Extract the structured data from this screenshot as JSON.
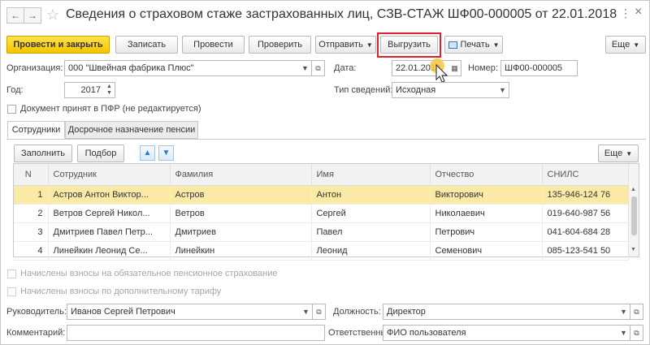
{
  "window": {
    "title": "Сведения о страховом стаже застрахованных лиц, СЗВ-СТАЖ ШФ00-000005 от 22.01.2018",
    "close_glyph": "×",
    "menu_glyph": "⋮"
  },
  "toolbar": {
    "post_close": "Провести и закрыть",
    "save": "Записать",
    "post": "Провести",
    "check": "Проверить",
    "send": "Отправить",
    "upload": "Выгрузить",
    "print": "Печать",
    "more": "Еще"
  },
  "form": {
    "org_label": "Организация:",
    "org_value": "000 \"Швейная фабрика Плюс\"",
    "date_label": "Дата:",
    "date_value": "22.01.2018",
    "number_label": "Номер:",
    "number_value": "ШФ00-000005",
    "year_label": "Год:",
    "year_value": "2017",
    "info_type_label": "Тип сведений:",
    "info_type_value": "Исходная",
    "accepted_label": "Документ принят в ПФР (не редактируется)"
  },
  "tabs": [
    {
      "label": "Сотрудники",
      "active": true
    },
    {
      "label": "Досрочное назначение пенсии",
      "active": false
    }
  ],
  "table_toolbar": {
    "fill": "Заполнить",
    "select": "Подбор",
    "more": "Еще"
  },
  "table": {
    "columns": [
      "N",
      "Сотрудник",
      "Фамилия",
      "Имя",
      "Отчество",
      "СНИЛС"
    ],
    "rows": [
      [
        "1",
        "Астров Антон Виктор...",
        "Астров",
        "Антон",
        "Викторович",
        "135-946-124 76"
      ],
      [
        "2",
        "Ветров Сергей Никол...",
        "Ветров",
        "Сергей",
        "Николаевич",
        "019-640-987 56"
      ],
      [
        "3",
        "Дмитриев Павел Петр...",
        "Дмитриев",
        "Павел",
        "Петрович",
        "041-604-684 28"
      ],
      [
        "4",
        "Линейкин Леонид Се...",
        "Линейкин",
        "Леонид",
        "Семенович",
        "085-123-541 50"
      ]
    ],
    "selected_row": 0
  },
  "bottom": {
    "contrib_main": "Начислены взносы на обязательное пенсионное страхование",
    "contrib_extra": "Начислены взносы по дополнительному тарифу",
    "head_label": "Руководитель:",
    "head_value": "Иванов Сергей Петрович",
    "position_label": "Должность:",
    "position_value": "Директор",
    "comment_label": "Комментарий:",
    "comment_value": "",
    "responsible_label": "Ответственный:",
    "responsible_value": "ФИО пользователя"
  },
  "colors": {
    "accent": "#f5c400",
    "highlight_box": "#e0202a",
    "selected_row": "#fbeaa5"
  }
}
